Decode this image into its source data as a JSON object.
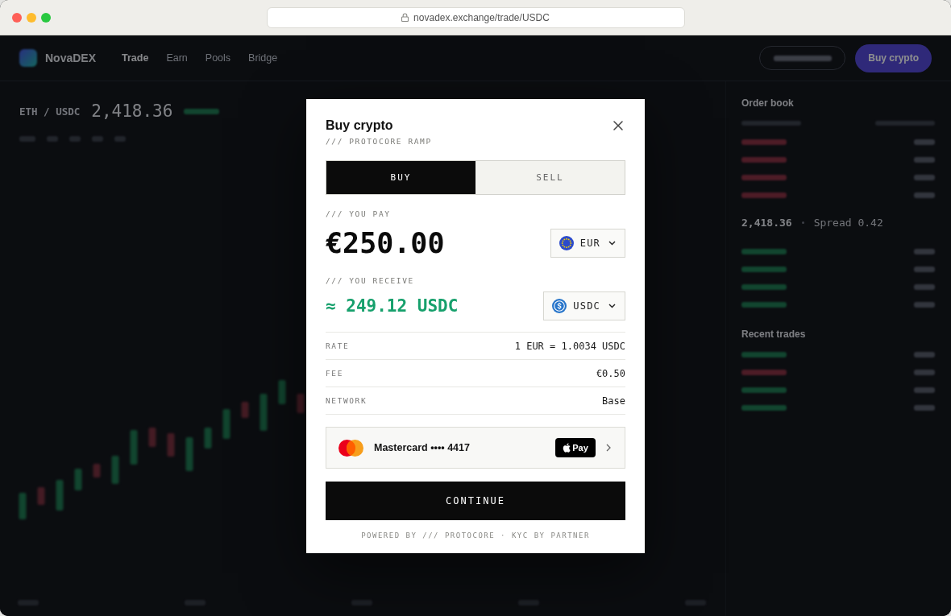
{
  "browser": {
    "url": "novadex.exchange/trade/USDC"
  },
  "app": {
    "brand": "NovaDEX",
    "nav": [
      {
        "label": "Trade",
        "selected": true
      },
      {
        "label": "Earn",
        "selected": false
      },
      {
        "label": "Pools",
        "selected": false
      },
      {
        "label": "Bridge",
        "selected": false
      }
    ],
    "buy_button": "Buy crypto",
    "market": {
      "pair": "ETH / USDC",
      "price": "2,418.36"
    },
    "order_book": {
      "title": "Order book",
      "mid": {
        "price": "2,418.36",
        "spread": "Spread 0.42"
      }
    },
    "recent_trades": {
      "title": "Recent trades",
      "rows": [
        {
          "kind": "buy"
        },
        {
          "kind": "sell"
        },
        {
          "kind": "buy"
        },
        {
          "kind": "buy"
        }
      ]
    }
  },
  "modal": {
    "title": "Buy crypto",
    "subtitle": "/// PROTOCORE RAMP",
    "tabs": [
      {
        "label": "BUY",
        "selected": true
      },
      {
        "label": "SELL",
        "selected": false
      }
    ],
    "pay": {
      "label": "/// YOU PAY",
      "amount": "€250.00",
      "currency": "EUR"
    },
    "receive": {
      "label": "/// YOU RECEIVE",
      "amount": "≈ 249.12 USDC",
      "currency": "USDC"
    },
    "details": [
      {
        "label": "RATE",
        "value": "1 EUR = 1.0034 USDC"
      },
      {
        "label": "FEE",
        "value": "€0.50"
      },
      {
        "label": "NETWORK",
        "value": "Base"
      }
    ],
    "payment": {
      "card": "Mastercard •••• 4417",
      "badge": "Pay"
    },
    "continue_button": "CONTINUE",
    "footer": "POWERED BY /// PROTOCORE · KYC BY PARTNER"
  }
}
